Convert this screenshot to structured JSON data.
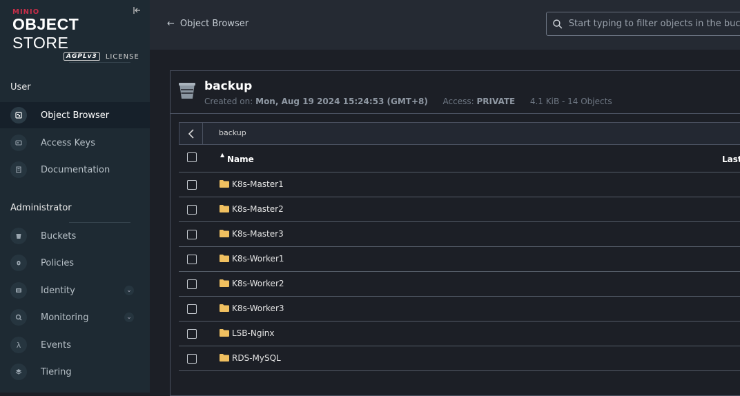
{
  "brand": {
    "minio": "MINIO",
    "object": "OBJECT",
    "store": "STORE",
    "agpl": "AGPLv3",
    "license": "LICENSE"
  },
  "sidebar": {
    "user_section": "User",
    "admin_section": "Administrator",
    "user_items": [
      {
        "label": "Object Browser",
        "icon": "object-browser-icon",
        "active": true
      },
      {
        "label": "Access Keys",
        "icon": "access-keys-icon"
      },
      {
        "label": "Documentation",
        "icon": "documentation-icon"
      }
    ],
    "admin_items": [
      {
        "label": "Buckets",
        "icon": "bucket-icon"
      },
      {
        "label": "Policies",
        "icon": "policy-icon"
      },
      {
        "label": "Identity",
        "icon": "identity-icon",
        "expandable": true
      },
      {
        "label": "Monitoring",
        "icon": "monitoring-icon",
        "expandable": true
      },
      {
        "label": "Events",
        "icon": "lambda-icon"
      },
      {
        "label": "Tiering",
        "icon": "tiering-icon"
      }
    ]
  },
  "topbar": {
    "back_label": "Object Browser",
    "search_placeholder": "Start typing to filter objects in the bucket"
  },
  "bucket": {
    "name": "backup",
    "created_label": "Created on:",
    "created_value": "Mon, Aug 19 2024 15:24:53 (GMT+8)",
    "access_label": "Access:",
    "access_value": "PRIVATE",
    "size_summary": "4.1 KiB - 14 Objects"
  },
  "path": {
    "current": "backup"
  },
  "table": {
    "col_name": "Name",
    "col_last": "Last",
    "rows": [
      "K8s-Master1",
      "K8s-Master2",
      "K8s-Master3",
      "K8s-Worker1",
      "K8s-Worker2",
      "K8s-Worker3",
      "LSB-Nginx",
      "RDS-MySQL"
    ]
  },
  "colors": {
    "sidebar_bg": "#1e2a33",
    "main_bg": "#1c1f26",
    "brand_red": "#c72e49",
    "folder": "#f0c060"
  }
}
